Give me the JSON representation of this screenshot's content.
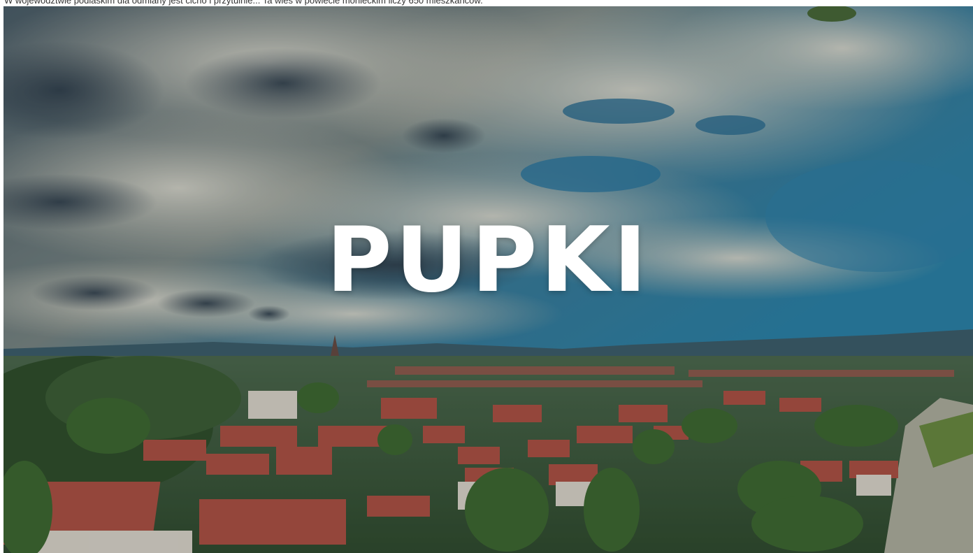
{
  "caption": "W województwie podlaskim dla odmiany jest cicho i przytulnie... Ta wieś w powiecie monieckim liczy 650 mieszkańców.",
  "hero": {
    "title": "PUPKI",
    "colors": {
      "sky_blue": "#2f7fa3",
      "cloud": "#d9d6c8",
      "roof": "#b64a3a",
      "tree": "#3f6b2c",
      "overlay": "rgba(30,40,50,0.25)"
    }
  }
}
